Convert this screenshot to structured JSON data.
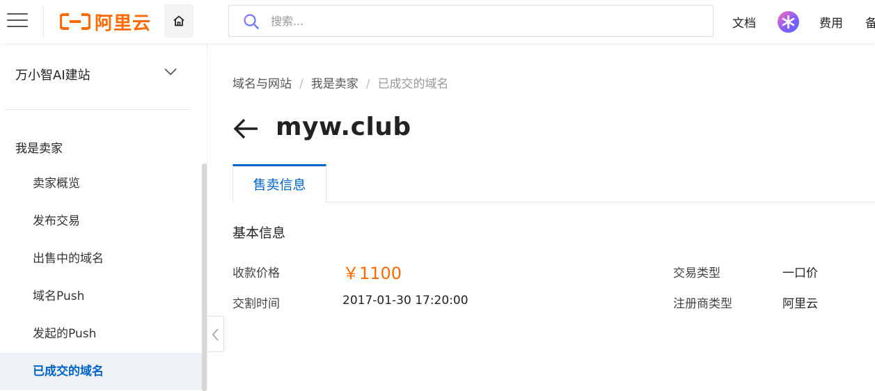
{
  "topbar": {
    "logo_text": "阿里云",
    "search_placeholder": "搜索...",
    "links": {
      "docs": "文档",
      "billing": "费用",
      "filing": "备"
    },
    "colors": {
      "brand": "#ff6a00"
    }
  },
  "sidebar": {
    "product": "万小智AI建站",
    "group_title": "我是卖家",
    "items": [
      {
        "label": "卖家概览"
      },
      {
        "label": "发布交易"
      },
      {
        "label": "出售中的域名"
      },
      {
        "label": "域名Push"
      },
      {
        "label": "发起的Push"
      },
      {
        "label": "已成交的域名",
        "active": true
      }
    ]
  },
  "breadcrumb": [
    "域名与网站",
    "我是卖家",
    "已成交的域名"
  ],
  "page": {
    "title": "myw.club",
    "tab": "售卖信息",
    "section_title": "基本信息",
    "fields": {
      "price_label": "收款价格",
      "price_value": "￥1100",
      "trade_type_label": "交易类型",
      "trade_type_value": "一口价",
      "delivery_time_label": "交割时间",
      "delivery_time_value": "2017-01-30 17:20:00",
      "registrar_type_label": "注册商类型",
      "registrar_type_value": "阿里云"
    }
  },
  "colors": {
    "accent": "#0064c8",
    "price": "#ff6a00"
  }
}
